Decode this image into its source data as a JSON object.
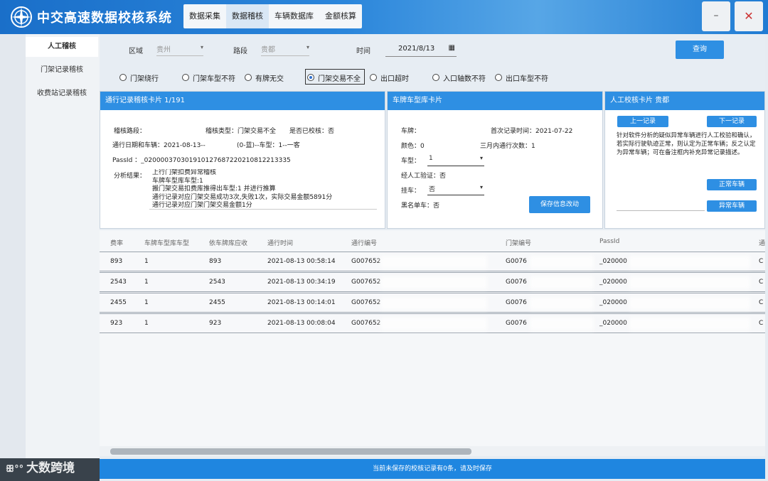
{
  "app": {
    "title": "中交高速数据校核系统"
  },
  "topnav": [
    "数据采集",
    "数据稽核",
    "车辆数据库",
    "金额核算"
  ],
  "window": {
    "minimize": "–",
    "close": "✕"
  },
  "sidebar": {
    "items": [
      "人工稽核",
      "门架记录稽核",
      "收费站记录稽核"
    ],
    "watermark": "大数跨境"
  },
  "filters": {
    "region_label": "区域",
    "region_value": "贵州",
    "road_label": "路段",
    "road_value": "贵都",
    "time_label": "时间",
    "date_value": "2021/8/13",
    "query_button": "查询"
  },
  "radios": [
    {
      "label": "门架绕行",
      "selected": false
    },
    {
      "label": "门架车型不符",
      "selected": false
    },
    {
      "label": "有牌无交",
      "selected": false
    },
    {
      "label": "门架交易不全",
      "selected": true
    },
    {
      "label": "出口超时",
      "selected": false
    },
    {
      "label": "入口轴数不符",
      "selected": false
    },
    {
      "label": "出口车型不符",
      "selected": false
    }
  ],
  "record_card": {
    "title": "通行记录稽核卡片 1/191",
    "road_label": "稽核路段：",
    "type_label": "稽核类型：门架交易不全",
    "verified_label": "是否已校核：否",
    "date_vehicle": "通行日期和车辆：2021-08-13--",
    "vehicle_detail": "(0-蓝)--车型：1--一客",
    "passid": "PassId ：_020000370301910127687220210812213335",
    "analysis_label": "分析结果：",
    "analysis_lines": [
      "上行门架扣费异常稽核",
      "车牌车型库车型:1",
      "搬门架交易扣费库推得出车型:1 并进行推算",
      "通行记录对应门架交易成功3次,失败1次，实际交易金额5891分",
      "通行记录对应门架门架交易金额1分"
    ]
  },
  "plate_card": {
    "title": "车牌车型库卡片",
    "plate_label": "车牌：",
    "first_record": "首次记录时间：2021-07-22",
    "color": "颜色：0",
    "count_3m": "三月内通行次数：1",
    "vtype_label": "车型：",
    "vtype_value": "1",
    "manual_verify": "经人工验证：否",
    "trailer_label": "挂车：",
    "trailer_value": "否",
    "blacklist": "黑名单车：否",
    "save_button": "保存信息改动"
  },
  "manual_card": {
    "title": "人工校核卡片 贵都",
    "prev_button": "上一记录",
    "next_button": "下一记录",
    "description": "针对软件分析的疑似异常车辆进行人工校验和确认，若实际行驶轨迹正常，则认定为正常车辆；反之认定为异常车辆；可在备注框内补充异常记录描述。",
    "normal_button": "正常车辆",
    "abnormal_button": "异常车辆"
  },
  "table": {
    "headers": [
      "费率",
      "车牌车型库车型",
      "依车牌库应收",
      "通行时间",
      "通行编号",
      "门架编号",
      "PassId",
      "通"
    ],
    "rows": [
      {
        "fee": "893",
        "vtype": "1",
        "due": "893",
        "time": "2021-08-13 00:58:14",
        "pass_no": "G007652",
        "gantry": "G0076",
        "passid": "_020000",
        "tail": "C"
      },
      {
        "fee": "2543",
        "vtype": "1",
        "due": "2543",
        "time": "2021-08-13 00:34:19",
        "pass_no": "G007652",
        "gantry": "G0076",
        "passid": "_020000",
        "tail": "C"
      },
      {
        "fee": "2455",
        "vtype": "1",
        "due": "2455",
        "time": "2021-08-13 00:14:01",
        "pass_no": "G007652",
        "gantry": "G0076",
        "passid": "_020000",
        "tail": "C"
      },
      {
        "fee": "923",
        "vtype": "1",
        "due": "923",
        "time": "2021-08-13 00:08:04",
        "pass_no": "G007652",
        "gantry": "G0076",
        "passid": "_020000",
        "tail": "C"
      }
    ]
  },
  "status": "当前未保存的校核记录有0条，请及时保存"
}
